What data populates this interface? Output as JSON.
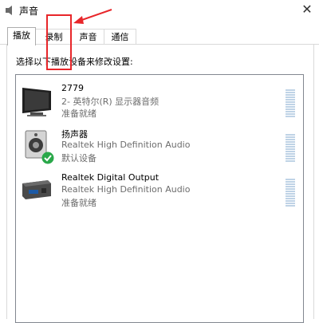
{
  "window": {
    "title": "声音"
  },
  "tabs": [
    {
      "label": "播放",
      "active": true
    },
    {
      "label": "录制",
      "active": false
    },
    {
      "label": "声音",
      "active": false
    },
    {
      "label": "通信",
      "active": false
    }
  ],
  "instruction": "选择以下播放设备来修改设置:",
  "devices": [
    {
      "name": "2779",
      "detail": "2- 英特尔(R) 显示器音频",
      "status": "准备就绪",
      "icon": "monitor-icon",
      "default": false
    },
    {
      "name": "扬声器",
      "detail": "Realtek High Definition Audio",
      "status": "默认设备",
      "icon": "speaker-icon",
      "default": true
    },
    {
      "name": "Realtek Digital Output",
      "detail": "Realtek High Definition Audio",
      "status": "准备就绪",
      "icon": "digital-output-icon",
      "default": false
    }
  ],
  "colors": {
    "annotation": "#e8262a",
    "default_check": "#2aa84a",
    "level_meter": "#bfd3e6"
  }
}
